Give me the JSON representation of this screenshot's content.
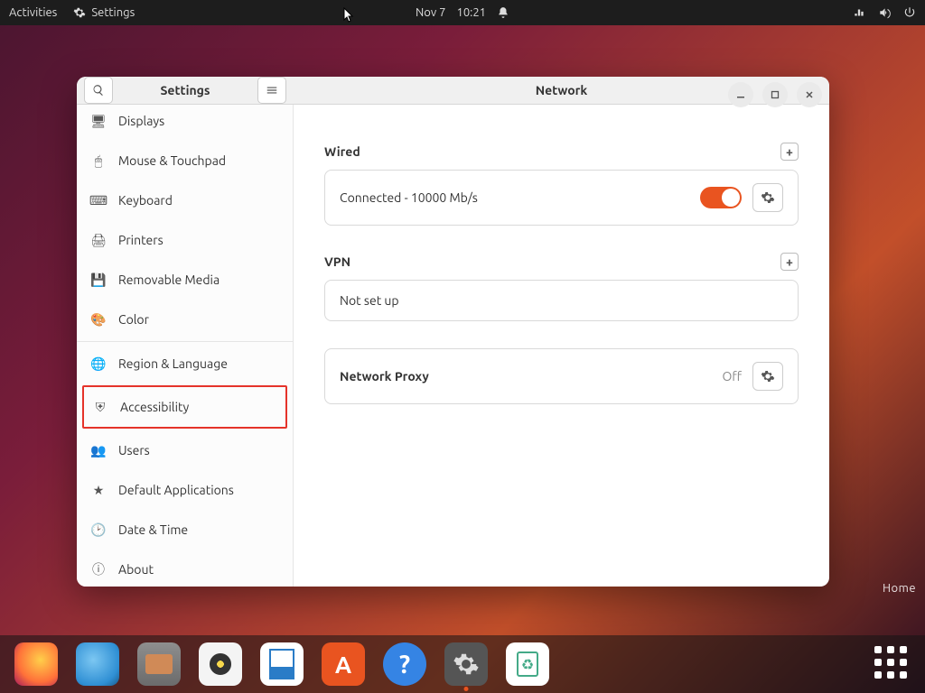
{
  "topbar": {
    "activities": "Activities",
    "app_name": "Settings",
    "date": "Nov 7",
    "time": "10:21"
  },
  "window": {
    "sidebar_title": "Settings",
    "content_title": "Network"
  },
  "sidebar": {
    "items": [
      {
        "label": "Displays",
        "icon": "display"
      },
      {
        "label": "Mouse & Touchpad",
        "icon": "mouse"
      },
      {
        "label": "Keyboard",
        "icon": "keyboard"
      },
      {
        "label": "Printers",
        "icon": "printer"
      },
      {
        "label": "Removable Media",
        "icon": "media"
      },
      {
        "label": "Color",
        "icon": "color"
      },
      {
        "label": "Region & Language",
        "icon": "globe"
      },
      {
        "label": "Accessibility",
        "icon": "accessibility",
        "highlighted": true
      },
      {
        "label": "Users",
        "icon": "users"
      },
      {
        "label": "Default Applications",
        "icon": "star"
      },
      {
        "label": "Date & Time",
        "icon": "clock"
      },
      {
        "label": "About",
        "icon": "info"
      }
    ]
  },
  "network": {
    "wired_title": "Wired",
    "wired_status": "Connected - 10000 Mb/s",
    "wired_enabled": true,
    "vpn_title": "VPN",
    "vpn_status": "Not set up",
    "proxy_title": "Network Proxy",
    "proxy_status": "Off"
  },
  "desktop": {
    "home_label": "Home"
  },
  "dock": {
    "apps": [
      {
        "name": "firefox",
        "color": "#ff7139"
      },
      {
        "name": "thunderbird",
        "color": "#2f8fd4"
      },
      {
        "name": "files",
        "color": "#d08a57"
      },
      {
        "name": "rhythmbox",
        "color": "#f4f4f4"
      },
      {
        "name": "libreoffice-writer",
        "color": "#ffffff"
      },
      {
        "name": "software",
        "color": "#e95420"
      },
      {
        "name": "help",
        "color": "#3584e4"
      },
      {
        "name": "settings",
        "color": "#4a4a4a",
        "active": true
      },
      {
        "name": "trash",
        "color": "#ffffff"
      }
    ]
  }
}
